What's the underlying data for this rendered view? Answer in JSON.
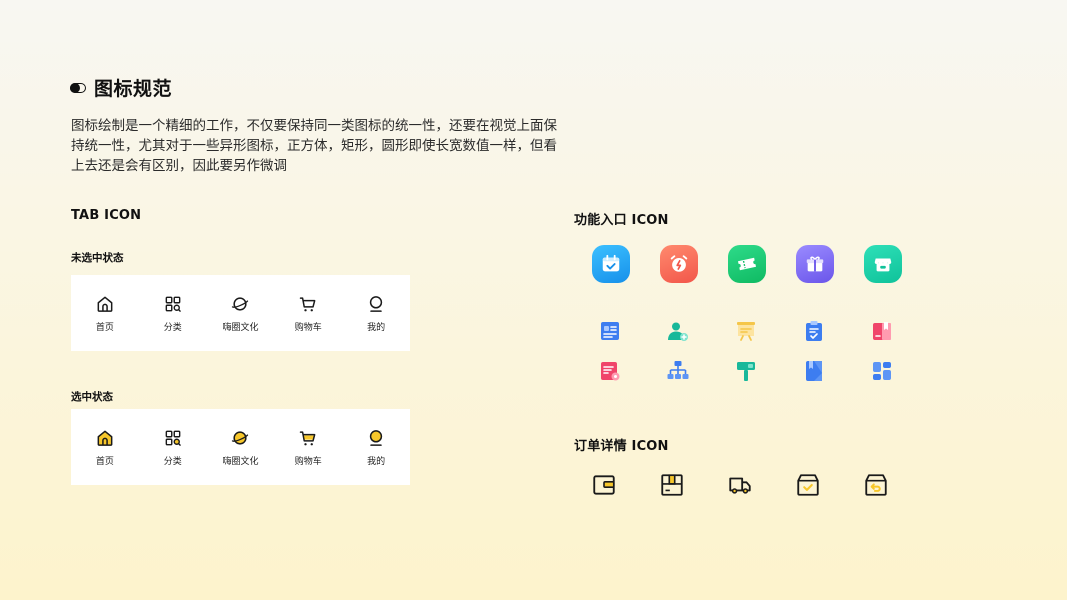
{
  "page": {
    "title": "图标规范",
    "description": "图标绘制是一个精细的工作，不仅要保持同一类图标的统一性，还要在视觉上面保持统一性，尤其对于一些异形图标，正方体，矩形，圆形即使长宽数值一样，但看上去还是会有区别，因此要另作微调"
  },
  "tab_icon": {
    "heading": "TAB ICON",
    "unselected_label": "未选中状态",
    "selected_label": "选中状态",
    "items": [
      {
        "label": "首页",
        "icon": "home-icon"
      },
      {
        "label": "分类",
        "icon": "category-icon"
      },
      {
        "label": "嗨圈文化",
        "icon": "planet-icon"
      },
      {
        "label": "购物车",
        "icon": "cart-icon"
      },
      {
        "label": "我的",
        "icon": "profile-icon"
      }
    ],
    "selected_fill_color": "#f7c72b"
  },
  "function_entry": {
    "heading": "功能入口 ICON",
    "large_icons": [
      {
        "icon": "calendar-check-icon",
        "color": "#1fa6f0"
      },
      {
        "icon": "alarm-clock-icon",
        "color": "#f56f5c"
      },
      {
        "icon": "ticket-icon",
        "color": "#16cc75"
      },
      {
        "icon": "gift-icon",
        "color": "#7d6cf2"
      },
      {
        "icon": "store-icon",
        "color": "#16cca8"
      }
    ],
    "small_icons_row1": [
      {
        "icon": "contact-card-icon",
        "color": "#3d7df0"
      },
      {
        "icon": "add-user-icon",
        "color": "#18b89a"
      },
      {
        "icon": "presentation-board-icon",
        "color": "#f5c649"
      },
      {
        "icon": "clipboard-check-icon",
        "color": "#3d7df0"
      },
      {
        "icon": "bookmark-book-icon",
        "color": "#f0456a"
      }
    ],
    "small_icons_row2": [
      {
        "icon": "document-settings-icon",
        "color": "#f0456a"
      },
      {
        "icon": "org-chart-icon",
        "color": "#3d7df0"
      },
      {
        "icon": "signpost-icon",
        "color": "#18b89a"
      },
      {
        "icon": "notebook-icon",
        "color": "#3d7df0"
      },
      {
        "icon": "dashboard-grid-icon",
        "color": "#3d7df0"
      }
    ]
  },
  "order_detail": {
    "heading": "订单详情 ICON",
    "icons": [
      {
        "icon": "wallet-icon"
      },
      {
        "icon": "package-icon"
      },
      {
        "icon": "delivery-truck-icon"
      },
      {
        "icon": "received-box-icon"
      },
      {
        "icon": "return-box-icon"
      }
    ],
    "accent_color": "#f7c72b"
  }
}
